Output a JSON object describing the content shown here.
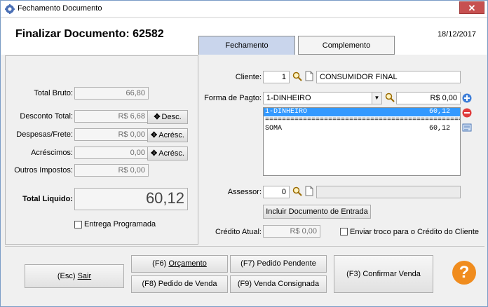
{
  "window": {
    "title": "Fechamento Documento",
    "close_label": "✕"
  },
  "header": {
    "doc_title": "Finalizar Documento: 62582",
    "date": "18/12/2017"
  },
  "tabs": [
    {
      "label": "Fechamento"
    },
    {
      "label": "Complemento"
    }
  ],
  "totals": {
    "total_bruto_label": "Total Bruto:",
    "total_bruto_value": "66,80",
    "desconto_label": "Desconto Total:",
    "desconto_value": "R$ 6,68",
    "desc_button": "Desc.",
    "despesas_label": "Despesas/Frete:",
    "despesas_value": "R$ 0,00",
    "acresc_button": "Acrésc.",
    "acrescimos_label": "Acréscimos:",
    "acrescimos_value": "0,00",
    "acresc_button2": "Acrésc.",
    "outros_label": "Outros Impostos:",
    "outros_value": "R$ 0,00",
    "liquido_label": "Total Liquido:",
    "liquido_value": "60,12",
    "entrega_label": "Entrega Programada"
  },
  "cliente": {
    "label": "Cliente:",
    "code": "1",
    "name": "CONSUMIDOR FINAL"
  },
  "pagamento": {
    "label": "Forma de Pagto:",
    "selected": "1-DINHEIRO",
    "amount": "R$ 0,00",
    "list": [
      {
        "text": "1-DINHEIRO",
        "value": "60,12",
        "selected": true
      },
      {
        "text": "===================================================",
        "value": "",
        "selected": false
      },
      {
        "text": "SOMA",
        "value": "60,12",
        "selected": false
      }
    ]
  },
  "assessor": {
    "label": "Assessor:",
    "code": "0",
    "name": ""
  },
  "incluir_button": "Incluir Documento de Entrada",
  "credito": {
    "label": "Crédito Atual:",
    "value": "R$ 0,00",
    "troco_label": "Enviar troco para o Crédito do Cliente"
  },
  "actions": {
    "sair": "Sair",
    "sair_key": "(Esc) ",
    "orcamento_key": "(F6) ",
    "orcamento": "Orçamento",
    "pedido_venda_key": "(F8) ",
    "pedido_venda": "Pedido de Venda",
    "pedido_pendente_key": "(F7) ",
    "pedido_pendente": "Pedido Pendente",
    "venda_consignada_key": "(F9) ",
    "venda_consignada": "Venda Consignada",
    "confirmar_key": "(F3) ",
    "confirmar": "Confirmar Venda",
    "help": "?"
  },
  "colors": {
    "accent_orange": "#f08c1e",
    "selection_blue": "#3399ff",
    "tab_active": "#c9d5ec"
  }
}
